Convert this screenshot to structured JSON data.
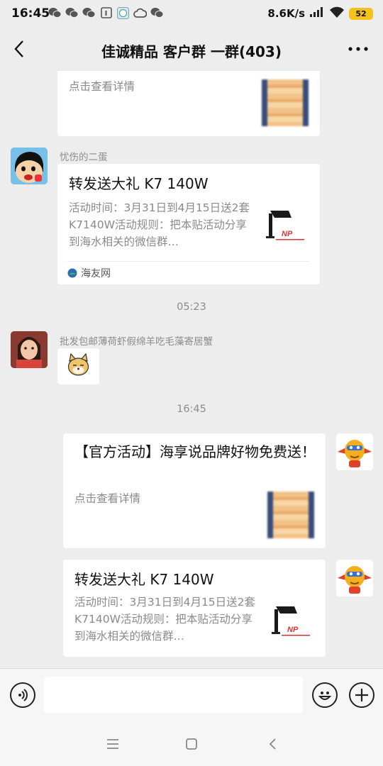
{
  "status_bar": {
    "time": "16:45",
    "net_speed": "8.6K/s",
    "battery": "52",
    "notification_icons": [
      "wechat-icon",
      "wechat-icon",
      "wechat-icon",
      "calendar-icon",
      "clock-app-icon",
      "cloud-icon",
      "wechat-icon"
    ]
  },
  "header": {
    "title": "佳诚精品 客户群 一群(403)"
  },
  "messages": [
    {
      "type": "card-partial",
      "desc": "点击查看详情"
    },
    {
      "sender": "忧伤的二蛋",
      "type": "link-card",
      "title": "转发送大礼 K7 140W",
      "desc": "活动时间：3月31日到4月15日送2套K7140W活动规则：把本贴活动分享到海水相关的微信群…",
      "source": "海友网"
    },
    {
      "type": "time",
      "text": "05:23"
    },
    {
      "sender": "批发包邮薄荷虾假绵羊吃毛藻寄居蟹",
      "type": "sticker"
    },
    {
      "type": "time",
      "text": "16:45"
    },
    {
      "type": "link-card-self",
      "title": "【官方活动】海享说品牌好物免费送！",
      "desc": "点击查看详情"
    },
    {
      "type": "link-card-self",
      "title": "转发送大礼 K7 140W",
      "desc": "活动时间：3月31日到4月15日送2套K7140W活动规则：把本贴活动分享到海水相关的微信群…"
    }
  ],
  "thumb_caption": "NP",
  "colors": {
    "background": "#ededed",
    "card": "#ffffff",
    "battery": "#f4c21c",
    "meta_text": "#8c8c8c"
  }
}
